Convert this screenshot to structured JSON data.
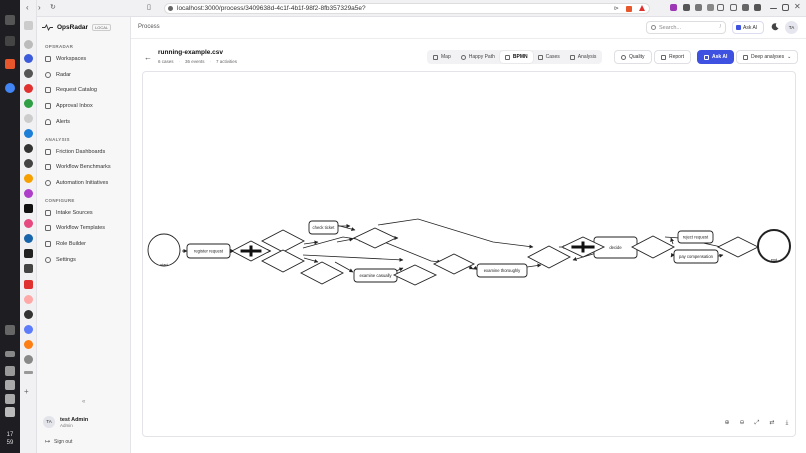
{
  "browser": {
    "url": "localhost:3000/process/3409638d-4c1f-4b1f-98f2-8fb357329a5e?"
  },
  "taskbar": {
    "clock_hour": "17",
    "clock_min": "59"
  },
  "app": {
    "name": "OpsRadar",
    "badge": "LOCAL"
  },
  "sidebar": {
    "sections": [
      {
        "title": "OPSRADAR",
        "items": [
          "Workspaces",
          "Radar",
          "Request Catalog",
          "Approval Inbox",
          "Alerts"
        ]
      },
      {
        "title": "ANALYSIS",
        "items": [
          "Friction Dashboards",
          "Workflow Benchmarks",
          "Automation Initiatives"
        ]
      },
      {
        "title": "CONFIGURE",
        "items": [
          "Intake Sources",
          "Workflow Templates",
          "Role Builder",
          "Settings"
        ]
      }
    ],
    "collapse_glyph": "«",
    "user": {
      "initials": "TA",
      "name": "test Admin",
      "role": "Admin"
    },
    "signout": "Sign out"
  },
  "header": {
    "breadcrumb": "Process",
    "search_placeholder": "Search...",
    "search_kbd": "/",
    "ask_ai": "Ask AI",
    "avatar": "TA"
  },
  "file": {
    "name": "running-example.csv",
    "cases": "6 cases",
    "events": "36 events",
    "activities": "7 activities"
  },
  "view_tabs": [
    {
      "label": "Map",
      "icon": "map-icon"
    },
    {
      "label": "Happy Path",
      "icon": "path-icon"
    },
    {
      "label": "BPMN",
      "icon": "bpmn-icon"
    },
    {
      "label": "Cases",
      "icon": "list-icon"
    },
    {
      "label": "Analysis",
      "icon": "chart-icon"
    }
  ],
  "active_view": "BPMN",
  "actions": {
    "quality": "Quality",
    "report": "Report",
    "ask_ai": "Ask AI",
    "deep": "Deep analyses"
  },
  "bpmn": {
    "start_label": "start",
    "end_label": "end",
    "tasks": {
      "register": "register request",
      "check": "check ticket",
      "casually": "examine casually",
      "thoroughly": "examine thoroughly",
      "decide": "decide",
      "reject": "reject request",
      "pay": "pay compensation"
    }
  }
}
